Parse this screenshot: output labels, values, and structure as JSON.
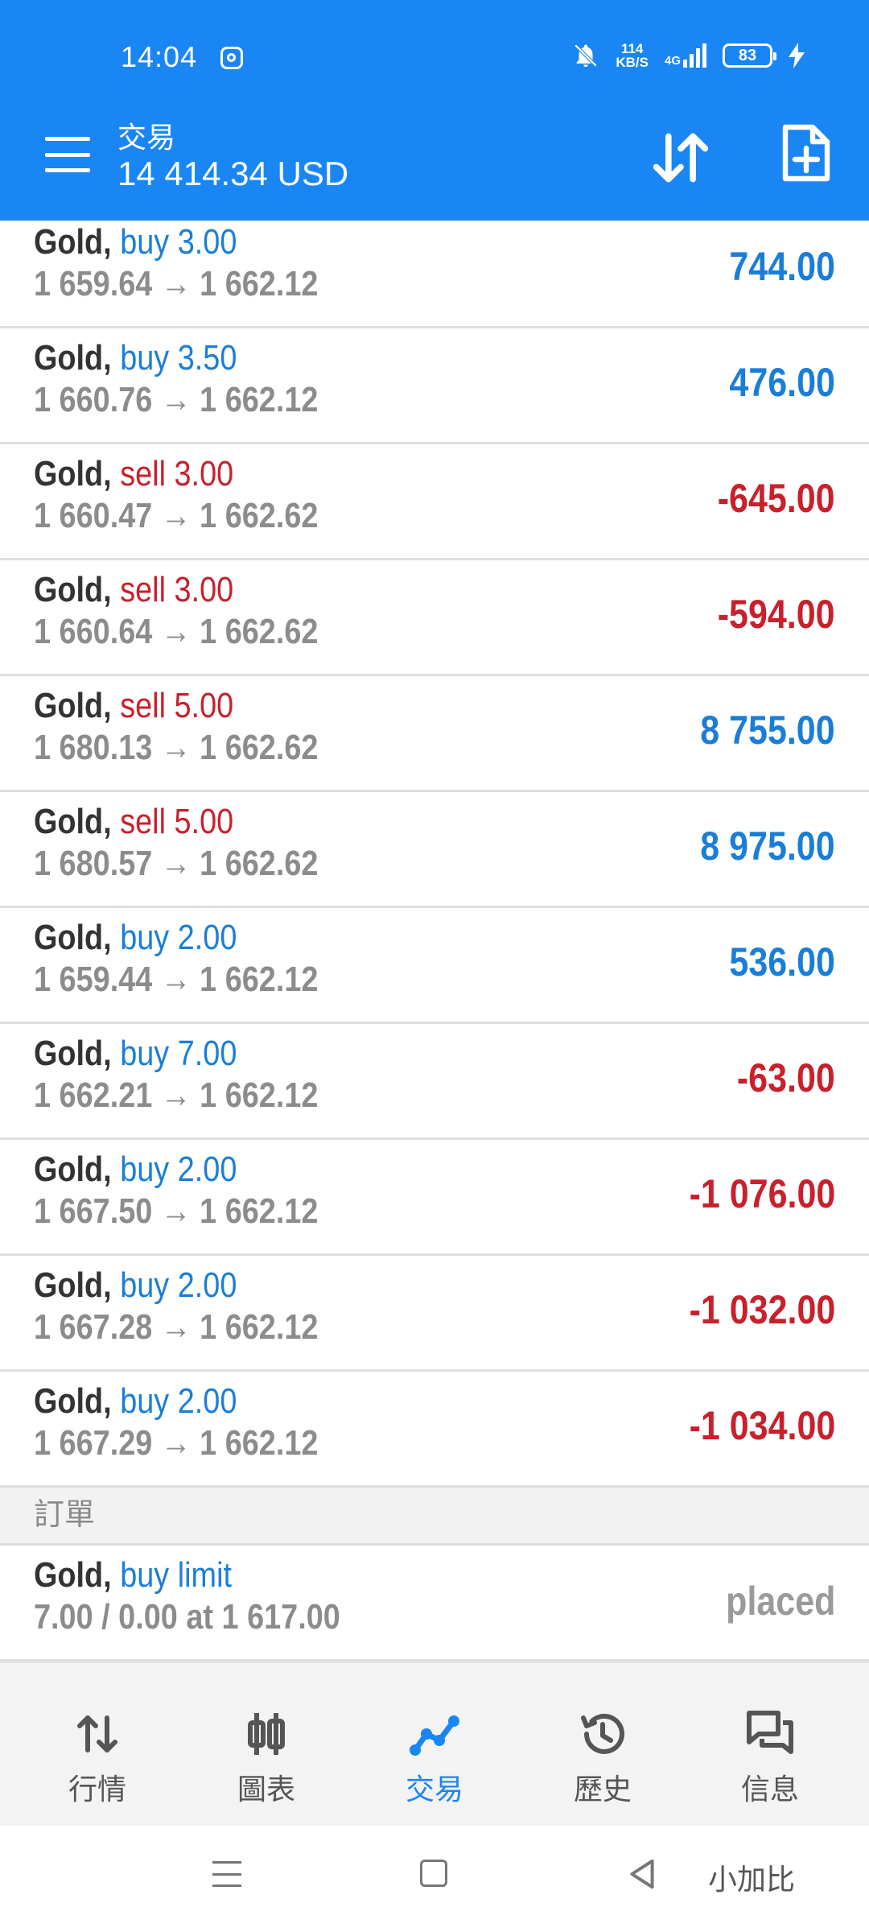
{
  "status_bar": {
    "time": "14:04",
    "speed_value": "114",
    "speed_unit": "KB/S",
    "network": "4G",
    "battery": "83",
    "icons": [
      "instagram-icon",
      "bell-off-icon",
      "signal-icon",
      "battery-icon",
      "charging-icon"
    ]
  },
  "header": {
    "title": "交易",
    "balance": "14 414.34 USD",
    "icons": [
      "menu-icon",
      "sort-icon",
      "new-order-icon"
    ]
  },
  "positions": [
    {
      "symbol": "Gold,",
      "direction": "buy 3.00",
      "type": "buy",
      "prices": "1 659.64 → 1 662.12",
      "profit": "744.00",
      "profit_sign": "pos"
    },
    {
      "symbol": "Gold,",
      "direction": "buy 3.50",
      "type": "buy",
      "prices": "1 660.76 → 1 662.12",
      "profit": "476.00",
      "profit_sign": "pos"
    },
    {
      "symbol": "Gold,",
      "direction": "sell 3.00",
      "type": "sell",
      "prices": "1 660.47 → 1 662.62",
      "profit": "-645.00",
      "profit_sign": "neg"
    },
    {
      "symbol": "Gold,",
      "direction": "sell 3.00",
      "type": "sell",
      "prices": "1 660.64 → 1 662.62",
      "profit": "-594.00",
      "profit_sign": "neg"
    },
    {
      "symbol": "Gold,",
      "direction": "sell 5.00",
      "type": "sell",
      "prices": "1 680.13 → 1 662.62",
      "profit": "8 755.00",
      "profit_sign": "pos"
    },
    {
      "symbol": "Gold,",
      "direction": "sell 5.00",
      "type": "sell",
      "prices": "1 680.57 → 1 662.62",
      "profit": "8 975.00",
      "profit_sign": "pos"
    },
    {
      "symbol": "Gold,",
      "direction": "buy 2.00",
      "type": "buy",
      "prices": "1 659.44 → 1 662.12",
      "profit": "536.00",
      "profit_sign": "pos"
    },
    {
      "symbol": "Gold,",
      "direction": "buy 7.00",
      "type": "buy",
      "prices": "1 662.21 → 1 662.12",
      "profit": "-63.00",
      "profit_sign": "neg"
    },
    {
      "symbol": "Gold,",
      "direction": "buy 2.00",
      "type": "buy",
      "prices": "1 667.50 → 1 662.12",
      "profit": "-1 076.00",
      "profit_sign": "neg"
    },
    {
      "symbol": "Gold,",
      "direction": "buy 2.00",
      "type": "buy",
      "prices": "1 667.28 → 1 662.12",
      "profit": "-1 032.00",
      "profit_sign": "neg"
    },
    {
      "symbol": "Gold,",
      "direction": "buy 2.00",
      "type": "buy",
      "prices": "1 667.29 → 1 662.12",
      "profit": "-1 034.00",
      "profit_sign": "neg"
    }
  ],
  "orders_section": {
    "title": "訂單",
    "orders": [
      {
        "symbol": "Gold,",
        "direction": "buy limit",
        "type": "buy",
        "details": "7.00 / 0.00 at 1 617.00",
        "status": "placed"
      }
    ]
  },
  "bottom_nav": [
    {
      "label": "行情",
      "icon": "quotes-icon",
      "active": false
    },
    {
      "label": "圖表",
      "icon": "chart-icon",
      "active": false
    },
    {
      "label": "交易",
      "icon": "trade-icon",
      "active": true
    },
    {
      "label": "歷史",
      "icon": "history-icon",
      "active": false
    },
    {
      "label": "信息",
      "icon": "messages-icon",
      "active": false
    }
  ],
  "watermark": "小加比",
  "colors": {
    "brand_blue": "#1a86f4",
    "profit_blue": "#1a7ed8",
    "loss_red": "#c9202c",
    "muted_gray": "#8c8c8c"
  }
}
